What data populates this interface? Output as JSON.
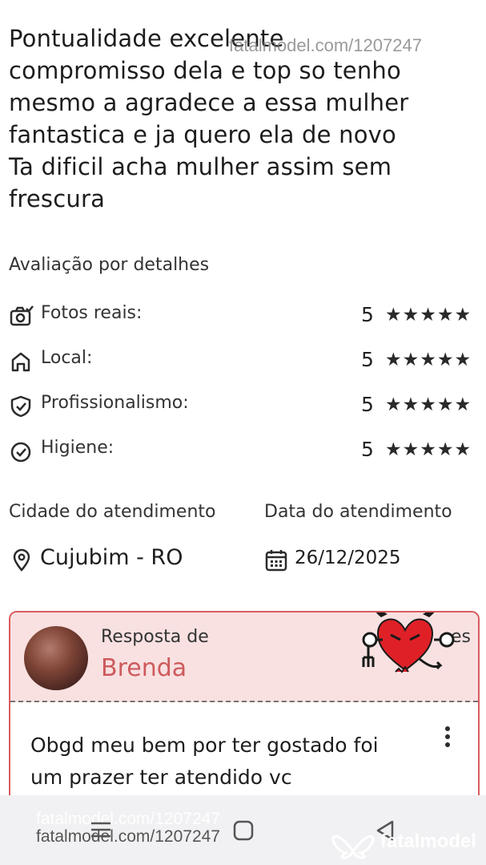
{
  "review": {
    "text_lines": [
      "Pontualidade excelente",
      "compromisso dela e top so tenho",
      "mesmo a agradece a essa mulher",
      "fantastica e ja quero ela de novo",
      "Ta dificil acha mulher assim sem",
      "frescura"
    ],
    "watermark": "fatalmodel.com/1207247"
  },
  "ratings": {
    "title": "Avaliação por detalhes",
    "items": [
      {
        "label": "Fotos reais:",
        "score": "5",
        "stars": "★★★★★",
        "icon": "camera-check-icon",
        "stars_value": 5
      },
      {
        "label": "Local:",
        "score": "5",
        "stars": "★★★★★",
        "icon": "home-icon",
        "stars_value": 5
      },
      {
        "label": "Profissionalismo:",
        "score": "5",
        "stars": "★★★★★",
        "icon": "shield-check-icon",
        "stars_value": 5
      },
      {
        "label": "Higiene:",
        "score": "5",
        "stars": "★★★★★",
        "icon": "check-circle-icon",
        "stars_value": 5
      }
    ]
  },
  "appointment": {
    "city_label": "Cidade do atendimento",
    "date_label": "Data do atendimento",
    "city": "Cujubim - RO",
    "date": "26/12/2025",
    "city_icon": "location-pin-icon",
    "date_icon": "calendar-icon"
  },
  "reply": {
    "from_label": "Resposta de",
    "name": "Brenda",
    "trailing_text": "es",
    "text_lines": [
      "Obgd meu bem por ter gostado foi",
      "um prazer ter atendido vc"
    ],
    "accent_color": "#d85c5f",
    "header_bg": "#f9e1e1"
  },
  "footer": {
    "watermark": "fatalmodel.com/1207247",
    "watermark_ghost": "fatalmodel.com/1207247",
    "brand": "fatalmodel"
  }
}
